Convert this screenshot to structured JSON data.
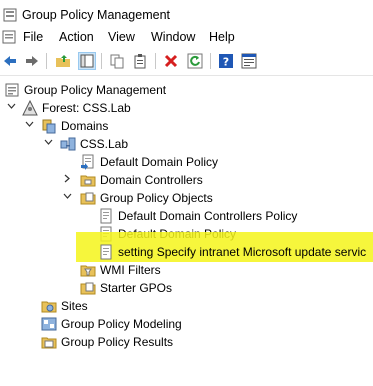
{
  "window": {
    "title": "Group Policy Management"
  },
  "menu": [
    "File",
    "Action",
    "View",
    "Window",
    "Help"
  ],
  "toolbar": {
    "buttons": [
      "back-icon",
      "forward-icon",
      "up-folder-icon",
      "show-tree-icon",
      "copy-icon",
      "paste-icon",
      "delete-icon",
      "refresh-icon",
      "help-icon",
      "properties-icon"
    ]
  },
  "tree": {
    "root": "Group Policy Management",
    "forest": "Forest: CSS.Lab",
    "domains": "Domains",
    "domain": "CSS.Lab",
    "default_domain_policy": "Default Domain Policy",
    "domain_controllers": "Domain Controllers",
    "gpo_folder": "Group Policy Objects",
    "gpo_items": [
      "Default Domain Controllers Policy",
      "Default Domain Policy",
      "setting Specify intranet Microsoft update servic"
    ],
    "wmi_filters": "WMI Filters",
    "starter_gpos": "Starter GPOs",
    "sites": "Sites",
    "modeling": "Group Policy Modeling",
    "results": "Group Policy Results"
  },
  "colors": {
    "highlight": "#f5f51a",
    "folder": "#e8c15a",
    "link_arrow": "#2c6fbf"
  }
}
